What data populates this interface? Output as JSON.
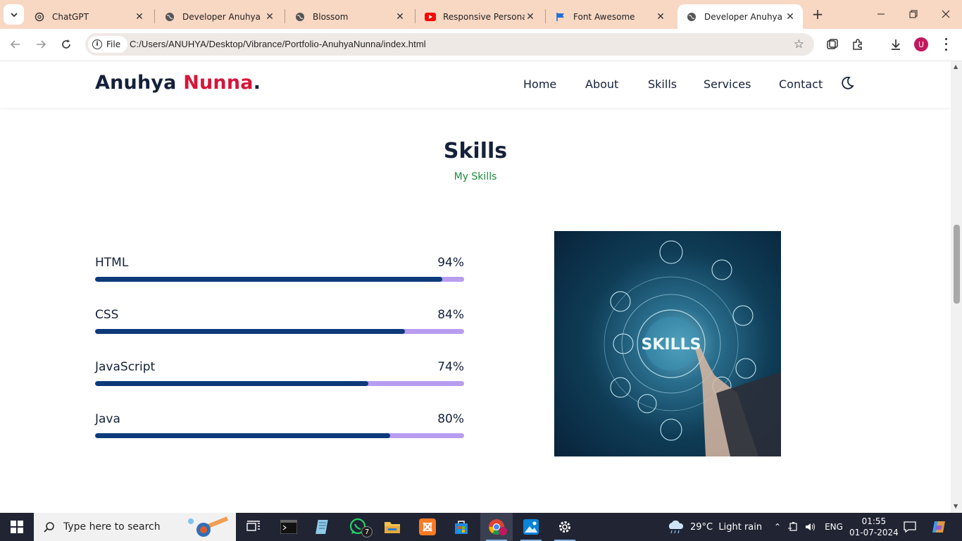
{
  "browser": {
    "tabs": [
      {
        "title": "ChatGPT",
        "icon": "chatgpt-icon",
        "active": false
      },
      {
        "title": "Developer Anuhya Nu",
        "icon": "globe-icon",
        "active": false
      },
      {
        "title": "Blossom",
        "icon": "globe-icon",
        "active": false
      },
      {
        "title": "Responsive Personal F",
        "icon": "youtube-icon",
        "active": false
      },
      {
        "title": "Font Awesome",
        "icon": "flag-icon",
        "active": false
      },
      {
        "title": "Developer Anuhya Nu",
        "icon": "globe-icon",
        "active": true
      }
    ],
    "new_tab_label": "+",
    "address": {
      "chip_label": "File",
      "url": "C:/Users/ANUHYA/Desktop/Vibrance/Portfolio-AnuhyaNunna/index.html"
    },
    "profile_initial": "U"
  },
  "site": {
    "logo": {
      "first": "Anuhya",
      "last": "Nunna",
      "dot": "."
    },
    "nav": [
      "Home",
      "About",
      "Skills",
      "Services",
      "Contact"
    ],
    "section_title": "Skills",
    "section_subtitle": "My Skills",
    "skills": [
      {
        "name": "HTML",
        "percent_label": "94%",
        "percent": 94
      },
      {
        "name": "CSS",
        "percent_label": "84%",
        "percent": 84
      },
      {
        "name": "JavaScript",
        "percent_label": "74%",
        "percent": 74
      },
      {
        "name": "Java",
        "percent_label": "80%",
        "percent": 80
      }
    ],
    "image_text": "SKILLS"
  },
  "taskbar": {
    "search_placeholder": "Type here to search",
    "whatsapp_badge": "7",
    "weather": "29°C  Light rain",
    "language": "ENG",
    "time": "01:55",
    "date": "01-07-2024"
  },
  "colors": {
    "accent_red": "#d6163a",
    "navy": "#15213a",
    "bar_fill": "#0d3a7a",
    "bar_track": "#b79cf0",
    "subtitle_green": "#1a8c3a"
  }
}
